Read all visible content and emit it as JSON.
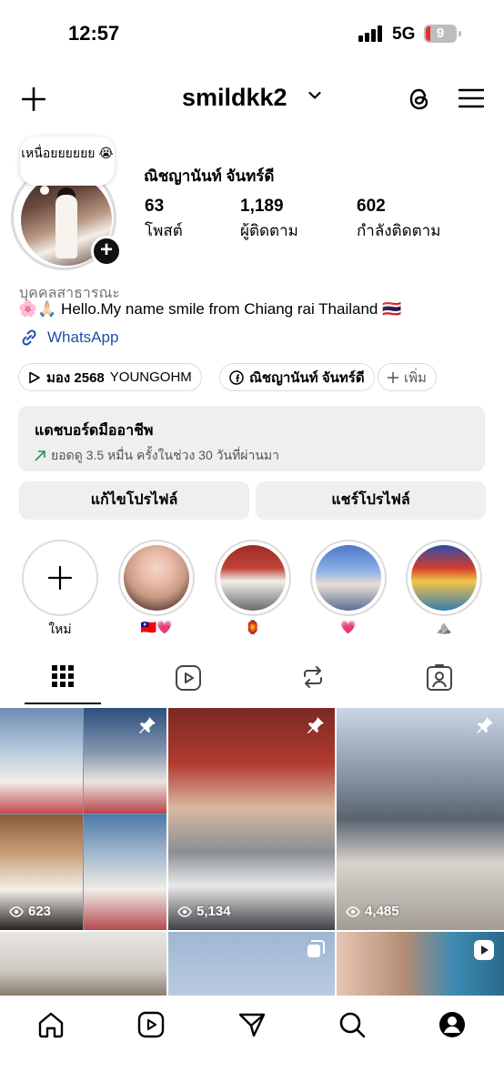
{
  "status": {
    "time": "12:57",
    "network": "5G",
    "battery": "9"
  },
  "header": {
    "username": "smildkk2"
  },
  "profile": {
    "note": "เหนื่อยยยยยย 😭",
    "full_name": "ณิชญานันท์ จันทร์ดี",
    "stats": [
      {
        "value": "63",
        "label": "โพสต์"
      },
      {
        "value": "1,189",
        "label": "ผู้ติดตาม"
      },
      {
        "value": "602",
        "label": "กำลังติดตาม"
      }
    ],
    "category": "บุคคลสาธารณะ",
    "bio": "🌸🙏🏻 Hello.My name smile from Chiang rai Thailand 🇹🇭",
    "link": "WhatsApp"
  },
  "chips": {
    "threads_bold": "มอง 2568",
    "threads_text": "YOUNGOHM",
    "facebook": "ณิชญานันท์ จันทร์ดี",
    "more": "เพิ่ม"
  },
  "dashboard": {
    "title": "แดชบอร์ดมืออาชีพ",
    "subtitle": "ยอดดู 3.5 หมื่น ครั้งในช่วง 30 วันที่ผ่านมา"
  },
  "buttons": {
    "edit": "แก้ไขโปรไฟล์",
    "share": "แชร์โปรไฟล์"
  },
  "highlights": [
    {
      "label": "ใหม่"
    },
    {
      "label": "🇹🇼💗"
    },
    {
      "label": "🏮"
    },
    {
      "label": "💗"
    },
    {
      "label": "⛰️"
    }
  ],
  "posts": [
    {
      "views": "623"
    },
    {
      "views": "5,134"
    },
    {
      "views": "4,485"
    }
  ],
  "colors": {
    "link": "#1f4fb0",
    "button_bg": "#efefef",
    "divider": "#dbdbdb",
    "trend_up": "#1a9a4b"
  }
}
